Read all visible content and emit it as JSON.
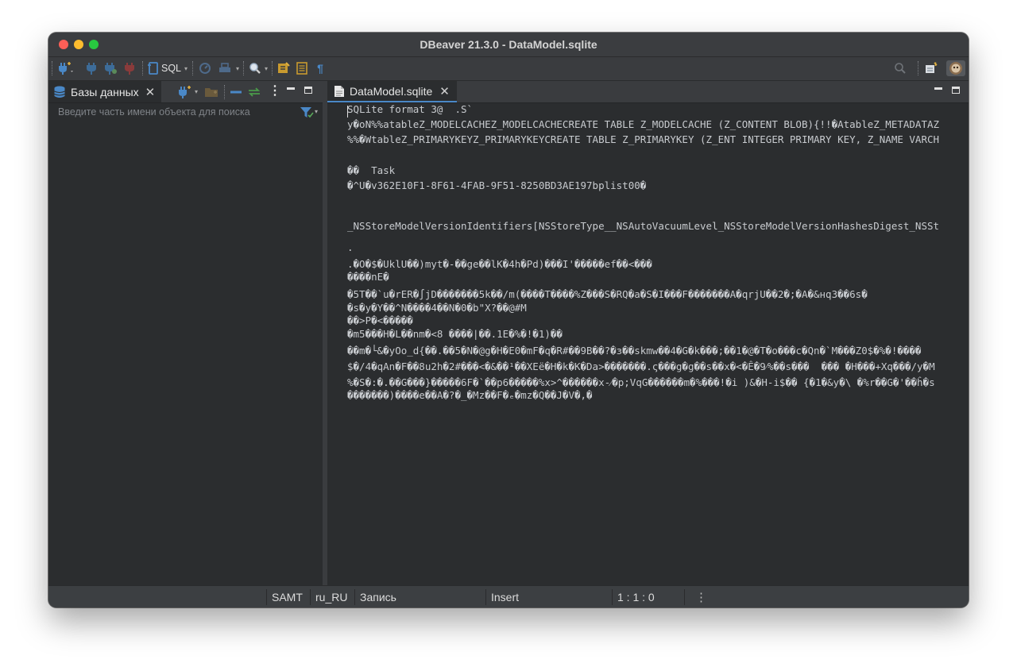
{
  "window": {
    "title": "DBeaver 21.3.0 - DataModel.sqlite"
  },
  "toolbar": {
    "sql_label": "SQL"
  },
  "left_panel": {
    "tab_label": "Базы данных",
    "search_placeholder": "Введите часть имени объекта для поиска"
  },
  "editor": {
    "tab_label": "DataModel.sqlite",
    "lines": [
      "SQLite format 3@  .S`",
      "y�oN%%atableZ_MODELCACHEZ_MODELCACHECREATE TABLE Z_MODELCACHE (Z_CONTENT BLOB){!!�AtableZ_METADATAZ",
      "%%�WtableZ_PRIMARYKEYZ_PRIMARYKEYCREATE TABLE Z_PRIMARYKEY (Z_ENT INTEGER PRIMARY KEY, Z_NAME VARCH",
      "��  Task",
      "�^U�v362E10F1-8F61-4FAB-9F51-8250BD3AE197bplist00�",
      "_NSStoreModelVersionIdentifiers[NSStoreType__NSAutoVacuumLevel_NSStoreModelVersionHashesDigest_NSSt",
      ".",
      ".�O�$�UklU��)myt�-��ge��lK�4h�Pd)���I'�����ef��<���",
      "����nE�",
      "�5T��`u�rER�∫jD�������5k��/m(����T����%Z���S�RQ�a�S�I���F�������A�qrjU��2�;�A�&нq3��6s�",
      "�s�y�Y��^N����4��N�0�b\"X?��@#M",
      "��>P�<�����",
      "�m5���H�L��nm�<8 ����|��.1E�%�!�1)��",
      "��m�└&�yOo_d{��.��5�N�@g�H�E0�mF�q�R#��9B��?�з��skmw��4�G�k���;��1�@�T�o���c�Qn�`M���Z0$�%�!����",
      "$�/4�qAn�F��8u2h�2#���<�&��¹��XEë�H�k�K�Da>�������.ς���g�g��s��x�<�Ê�9⁄%��s���  ��� �H���+Xq���/y�M",
      "%�S�:�.��G���}�����6F�`��p6�����%x>^������x-⁄�p;VqG������m�%���!�i )&�H-i$�� {�1�&y�\\ �%r��G�'��ĥ�s",
      "�������)����e��A�?�_�Mz��F�ₑ�mz�Q��J�V�,�"
    ]
  },
  "statusbar": {
    "timezone": "SAMT",
    "locale": "ru_RU",
    "mode_label": "Запись",
    "insert_mode": "Insert",
    "position": "1 : 1 : 0"
  },
  "colors": {
    "accent": "#4a88c7",
    "background": "#2b2d2f",
    "panel_header": "#3a3c3f"
  }
}
